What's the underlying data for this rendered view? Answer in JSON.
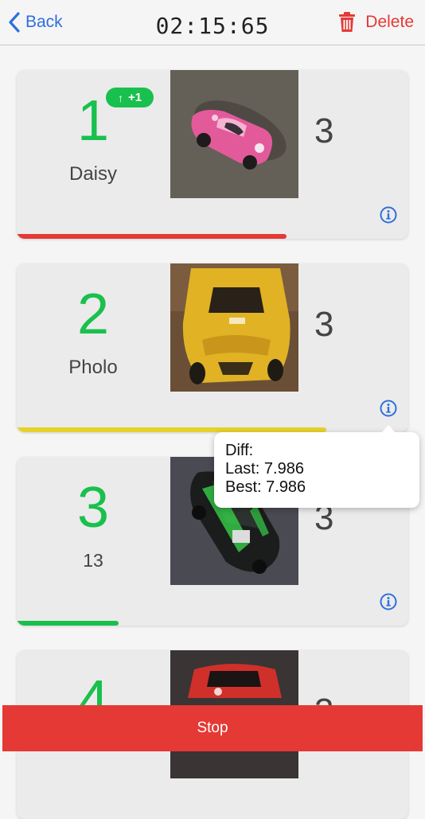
{
  "header": {
    "back_label": "Back",
    "timer": "02:15:65",
    "delete_label": "Delete",
    "accent_color": "#2f6fdd",
    "delete_color": "#e53935"
  },
  "racers": [
    {
      "position": "1",
      "name": "Daisy",
      "badge": "+1",
      "laps": "3",
      "progress": 0.69,
      "progress_color": "#e53935"
    },
    {
      "position": "2",
      "name": "Pholo",
      "laps": "3",
      "progress": 0.79,
      "progress_color": "#e6d22b"
    },
    {
      "position": "3",
      "name": "13",
      "laps": "3",
      "progress": 0.26,
      "progress_color": "#19c04e"
    },
    {
      "position": "4",
      "laps": "3"
    }
  ],
  "tooltip": {
    "diff": "Diff:",
    "last": "Last: 7.986",
    "best": "Best: 7.986"
  },
  "footer": {
    "stop_label": "Stop"
  }
}
